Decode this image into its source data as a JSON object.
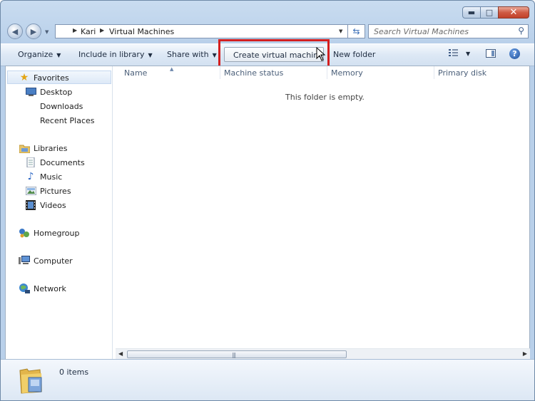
{
  "window": {
    "min_glyph": "▬",
    "max_glyph": "□",
    "close_glyph": "✕"
  },
  "breadcrumb": [
    "Kari",
    "Virtual Machines"
  ],
  "search": {
    "placeholder": "Search Virtual Machines"
  },
  "toolbar": {
    "organize": "Organize",
    "include_in_library": "Include in library",
    "share_with": "Share with",
    "create_vm": "Create virtual machine",
    "new_folder": "New folder",
    "help": "?"
  },
  "nav": {
    "favorites": "Favorites",
    "desktop": "Desktop",
    "downloads": "Downloads",
    "recent_places": "Recent Places",
    "libraries": "Libraries",
    "documents": "Documents",
    "music": "Music",
    "pictures": "Pictures",
    "videos": "Videos",
    "homegroup": "Homegroup",
    "computer": "Computer",
    "network": "Network"
  },
  "columns": [
    "Name",
    "Machine status",
    "Memory",
    "Primary disk"
  ],
  "content": {
    "empty_text": "This folder is empty."
  },
  "status": {
    "items": "0 items"
  },
  "colors": {
    "highlight": "#d41f1f",
    "window_frame": "#b9d0ea"
  }
}
